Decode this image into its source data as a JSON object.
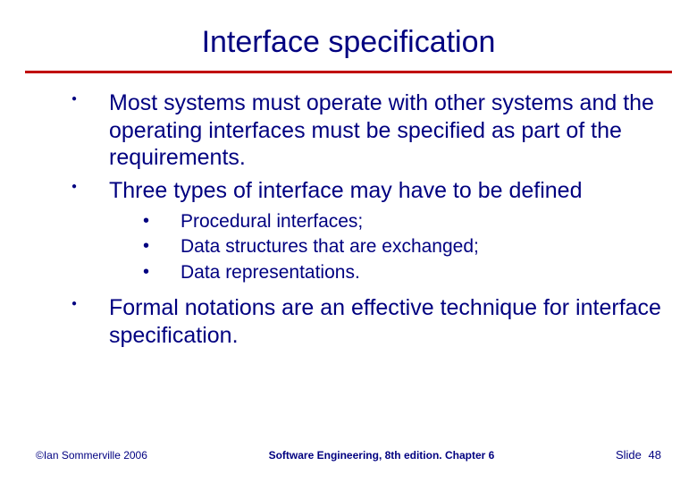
{
  "title": "Interface specification",
  "bullets": {
    "b1": "Most systems must operate with other systems and the operating interfaces must be specified as part of the requirements.",
    "b2": "Three types of interface may have to be defined",
    "sub1": "Procedural interfaces;",
    "sub2": "Data structures that are exchanged;",
    "sub3": "Data representations.",
    "b3": "Formal notations are an effective technique for interface specification."
  },
  "footer": {
    "copyright": "©Ian Sommerville 2006",
    "center": "Software Engineering, 8th edition. Chapter 6",
    "slide_label": "Slide",
    "slide_number": "48"
  }
}
